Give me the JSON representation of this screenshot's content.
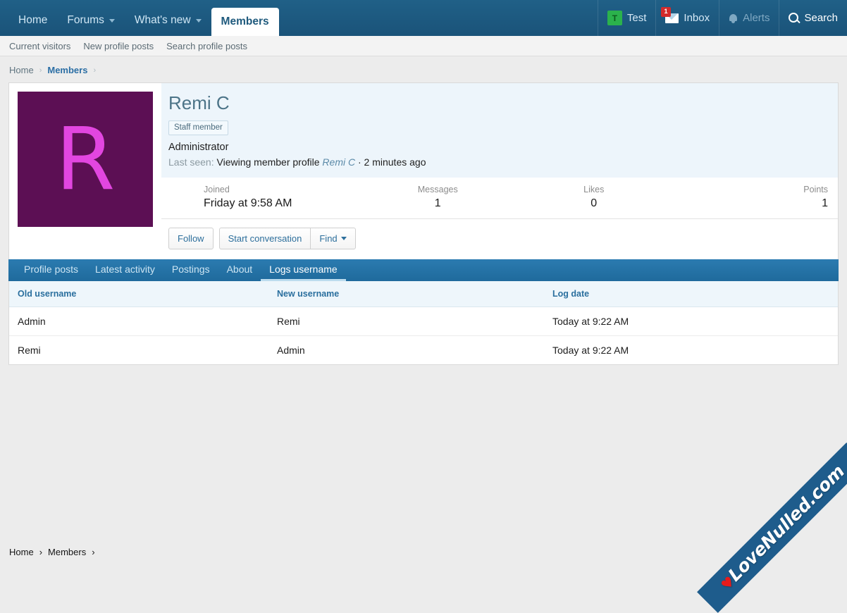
{
  "nav": {
    "left_items": [
      {
        "label": "Home",
        "has_caret": false,
        "active": false
      },
      {
        "label": "Forums",
        "has_caret": true,
        "active": false
      },
      {
        "label": "What's new",
        "has_caret": true,
        "active": false
      },
      {
        "label": "Members",
        "has_caret": false,
        "active": true
      }
    ],
    "right_items": [
      {
        "label": "Test",
        "icon": "user-avatar-icon",
        "avatar_letter": "T",
        "state": "normal"
      },
      {
        "label": "Inbox",
        "icon": "envelope-icon",
        "badge": "1",
        "state": "normal"
      },
      {
        "label": "Alerts",
        "icon": "bell-icon",
        "state": "dim"
      },
      {
        "label": "Search",
        "icon": "magnifier-icon",
        "state": "bright"
      }
    ]
  },
  "subnav": {
    "items": [
      "Current visitors",
      "New profile posts",
      "Search profile posts"
    ]
  },
  "breadcrumb": {
    "home": "Home",
    "current": "Members",
    "sep": "›"
  },
  "profile": {
    "avatar_letter": "R",
    "username": "Remi C",
    "staff_badge": "Staff member",
    "user_title": "Administrator",
    "last_seen_label": "Last seen:",
    "last_seen_activity": "Viewing member profile",
    "last_seen_link": "Remi C",
    "last_seen_time": "· 2 minutes ago",
    "stats": [
      {
        "key": "Joined",
        "value": "Friday at 9:58 AM"
      },
      {
        "key": "Messages",
        "value": "1"
      },
      {
        "key": "Likes",
        "value": "0"
      },
      {
        "key": "Points",
        "value": "1"
      }
    ],
    "actions": {
      "follow": "Follow",
      "start_conversation": "Start conversation",
      "find": "Find"
    }
  },
  "tabs": [
    {
      "label": "Profile posts",
      "active": false
    },
    {
      "label": "Latest activity",
      "active": false
    },
    {
      "label": "Postings",
      "active": false
    },
    {
      "label": "About",
      "active": false
    },
    {
      "label": "Logs username",
      "active": true
    }
  ],
  "table": {
    "headers": [
      "Old username",
      "New username",
      "Log date"
    ],
    "rows": [
      {
        "old": "Admin",
        "new": "Remi",
        "date": "Today at 9:22 AM"
      },
      {
        "old": "Remi",
        "new": "Admin",
        "date": "Today at 9:22 AM"
      }
    ]
  },
  "watermark": {
    "heart": "♥",
    "text": "LoveNulled.com"
  },
  "colors": {
    "nav_blue": "#1b5b83",
    "tab_blue": "#2b7bb0",
    "link_blue": "#2c6fa5",
    "avatar_bg": "#5c0f54",
    "avatar_fg": "#e246e0",
    "badge_red": "#d32b2b",
    "mini_avatar_green": "#2bb24c",
    "page_bg": "#ececec"
  }
}
